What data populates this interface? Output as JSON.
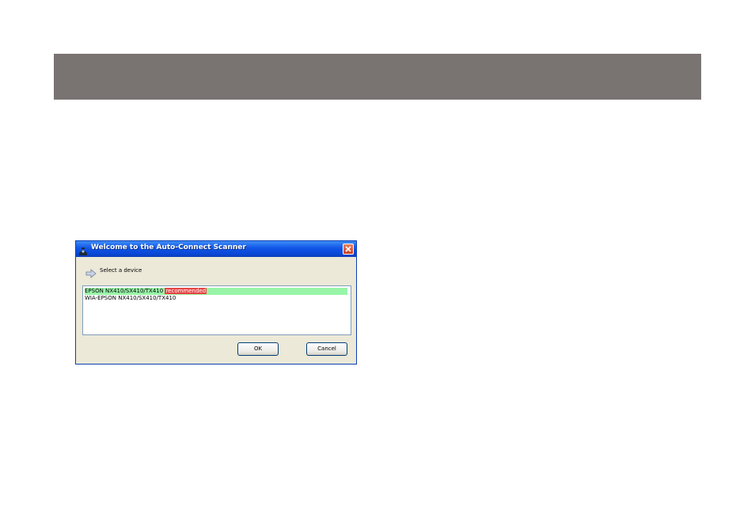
{
  "dialog": {
    "title": "Welcome to the Auto-Connect Scanner",
    "prompt": "Select a device",
    "devices": [
      {
        "name": "EPSON NX410/SX410/TX410",
        "badge": "recommended",
        "selected": true
      },
      {
        "name": "WIA-EPSON NX410/SX410/TX410",
        "badge": "",
        "selected": false
      }
    ],
    "ok_label": "OK",
    "cancel_label": "Cancel"
  },
  "icons": {
    "title": "scanner-icon",
    "close": "close-icon",
    "prompt": "arrow-icon"
  },
  "colors": {
    "header_band": "#797372",
    "selection": "#98f5a8",
    "badge": "#e74444",
    "titlebar": "#0a47d6"
  }
}
